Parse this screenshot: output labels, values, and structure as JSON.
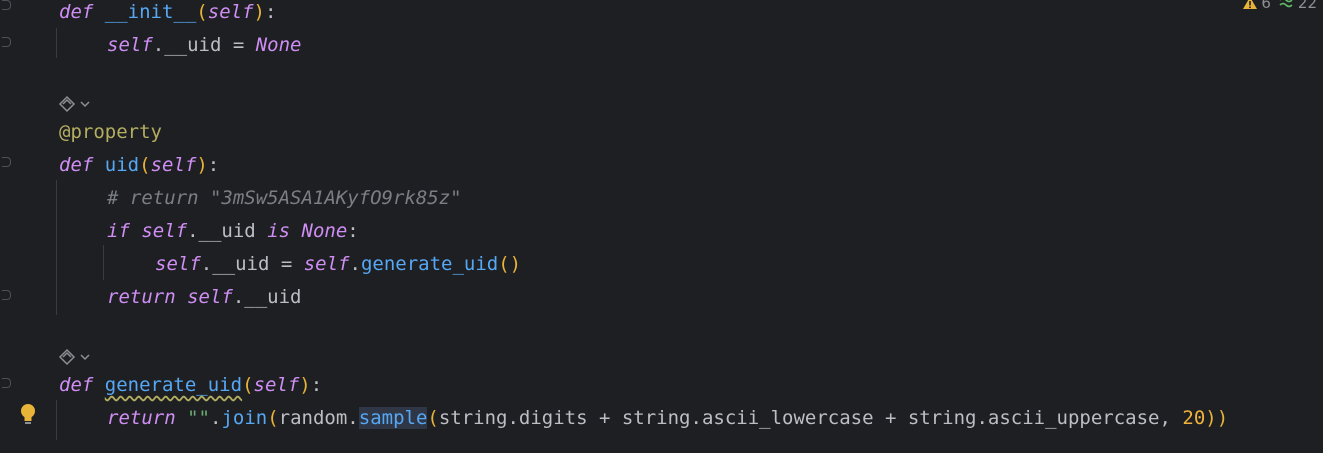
{
  "inspections": {
    "warnings": "6",
    "weak_warnings": "22"
  },
  "inlay_hint_label": "",
  "code": {
    "l1": {
      "kw": "def",
      "name": "__init__",
      "open": "(",
      "param": "self",
      "close": ")",
      "colon": ":"
    },
    "l2": {
      "self": "self",
      "attr": ".__uid = ",
      "none": "None"
    },
    "l4": {
      "deco": "@property"
    },
    "l5": {
      "kw": "def",
      "name": "uid",
      "open": "(",
      "param": "self",
      "close": ")",
      "colon": ":"
    },
    "l6": {
      "comment": "# return \"3mSw5ASA1AKyfO9rk85z\""
    },
    "l7": {
      "kw_if": "if",
      "self": "self",
      "attr": ".__uid ",
      "kw_is": "is",
      "none": "None",
      "colon": ":"
    },
    "l8": {
      "self": "self",
      "attr": ".__uid = ",
      "self2": "self",
      "dot": ".",
      "call": "generate_uid",
      "parens": "()"
    },
    "l9": {
      "kw": "return",
      "self": "self",
      "attr": ".__uid"
    },
    "l11": {
      "kw": "def",
      "name": "generate_uid",
      "open": "(",
      "param": "self",
      "close": ")",
      "colon": ":"
    },
    "l12": {
      "kw": "return",
      "str": "\"\"",
      "dot": ".",
      "join": "join",
      "open": "(",
      "mod": "random",
      "dot2": ".",
      "sample": "sample",
      "open2": "(",
      "args": "string.digits + string.ascii_lowercase + string.ascii_uppercase, ",
      "num": "20",
      "close": "))"
    }
  }
}
